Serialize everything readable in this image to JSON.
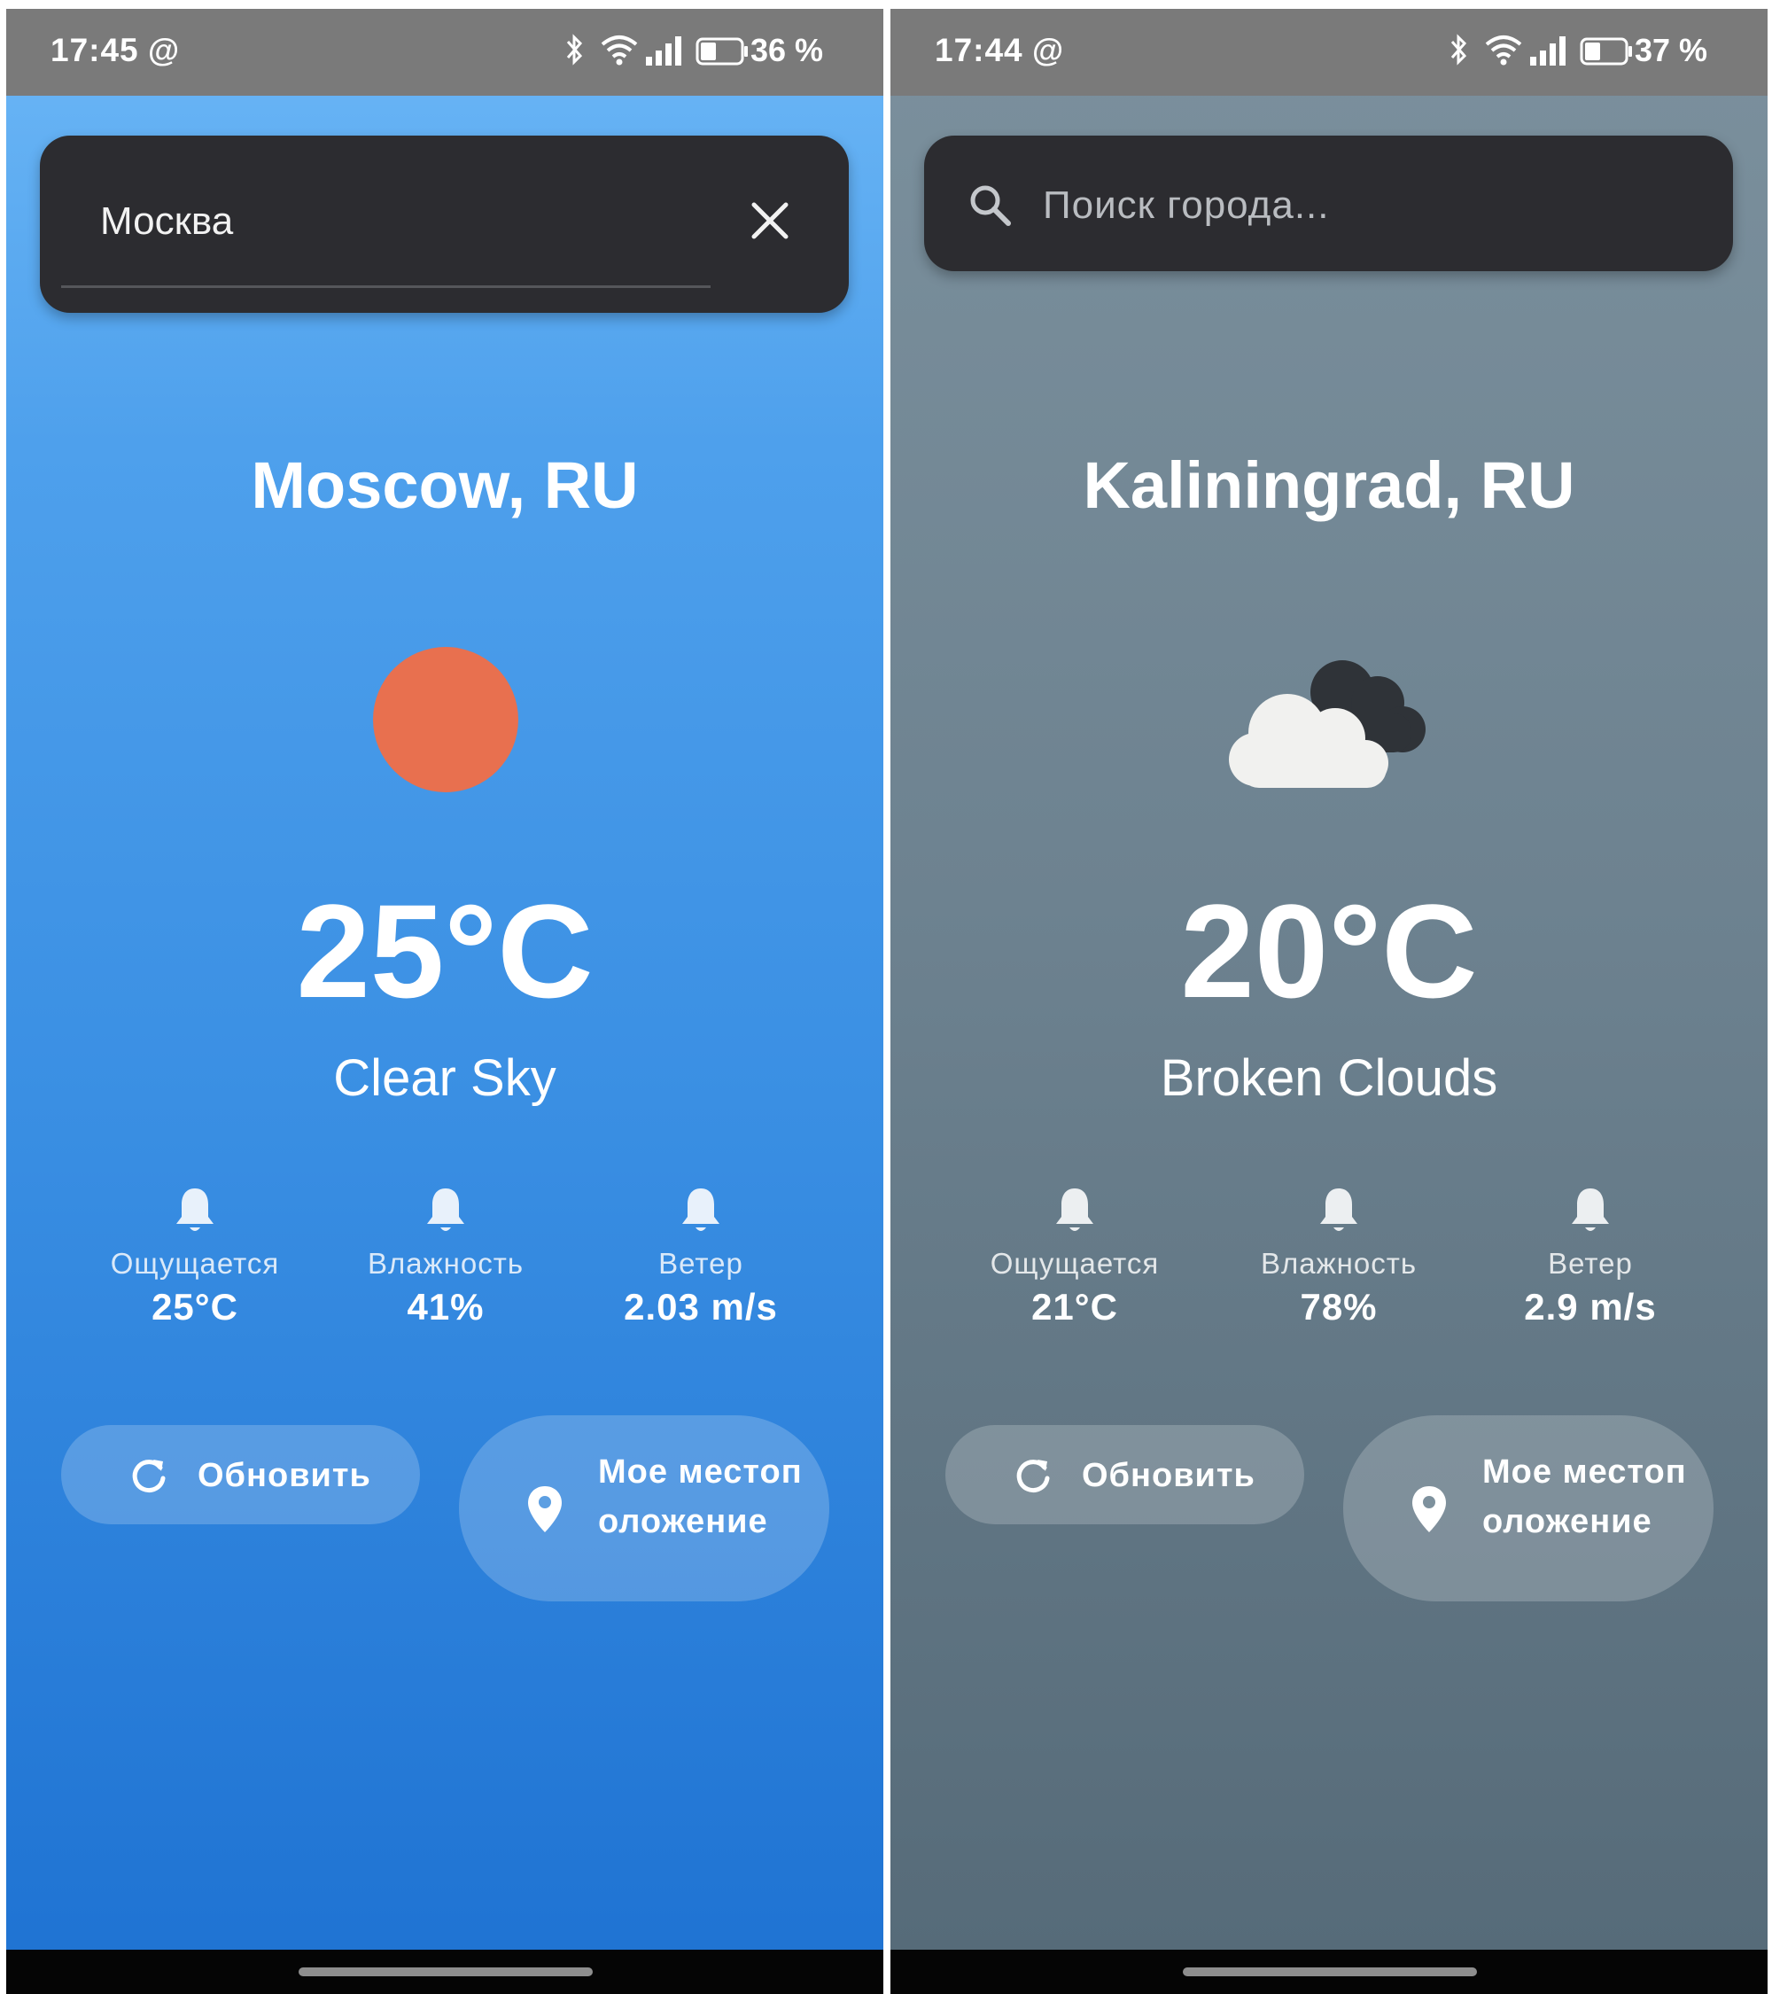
{
  "screens": [
    {
      "status": {
        "time": "17:45",
        "at_sign": "@",
        "battery": "36 %"
      },
      "search": {
        "value": "Москва"
      },
      "city": "Moscow, RU",
      "weather_icon": "sun-icon",
      "temperature": "25°C",
      "condition": "Clear Sky",
      "stats": [
        {
          "label": "Ощущается",
          "value": "25°C"
        },
        {
          "label": "Влажность",
          "value": "41%"
        },
        {
          "label": "Ветер",
          "value": "2.03 m/s"
        }
      ],
      "buttons": {
        "refresh": "Обновить",
        "location": "Мое местоположение"
      },
      "colors": {
        "background_top": "#6cb7f6",
        "background_bottom": "#1e72d2",
        "sun": "#e8704f"
      }
    },
    {
      "status": {
        "time": "17:44",
        "at_sign": "@",
        "battery": "37 %"
      },
      "search": {
        "placeholder": "Поиск города..."
      },
      "city": "Kaliningrad, RU",
      "weather_icon": "broken-clouds-icon",
      "temperature": "20°C",
      "condition": "Broken Clouds",
      "stats": [
        {
          "label": "Ощущается",
          "value": "21°C"
        },
        {
          "label": "Влажность",
          "value": "78%"
        },
        {
          "label": "Ветер",
          "value": "2.9 m/s"
        }
      ],
      "buttons": {
        "refresh": "Обновить",
        "location": "Мое местоположение"
      },
      "colors": {
        "background_top": "#7b909d",
        "background_bottom": "#556a78"
      }
    }
  ],
  "colors": {
    "search_card": "#2c2c30",
    "status_bar": "#7a7a7a",
    "nav_bar": "#050505"
  }
}
